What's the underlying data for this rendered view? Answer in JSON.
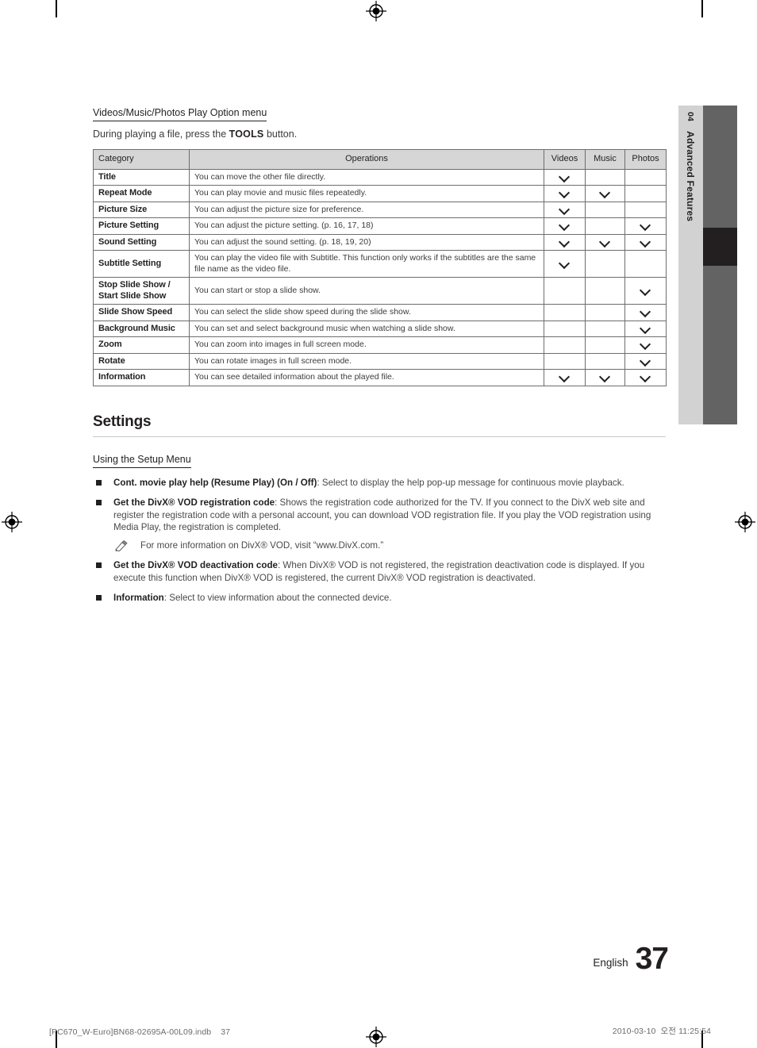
{
  "chapter_tab": {
    "number": "04",
    "name": "Advanced Features"
  },
  "play_option_section": {
    "heading": "Videos/Music/Photos Play Option menu",
    "lead_prefix": "During playing a file, press the ",
    "lead_key": "TOOLS",
    "lead_suffix": " button.",
    "table": {
      "headers": [
        "Category",
        "Operations",
        "Videos",
        "Music",
        "Photos"
      ],
      "rows": [
        {
          "category": "Title",
          "operations": "You can move the other file directly.",
          "videos": true,
          "music": false,
          "photos": false
        },
        {
          "category": "Repeat Mode",
          "operations": "You can play movie and music files repeatedly.",
          "videos": true,
          "music": true,
          "photos": false
        },
        {
          "category": "Picture Size",
          "operations": "You can adjust the picture size for preference.",
          "videos": true,
          "music": false,
          "photos": false
        },
        {
          "category": "Picture Setting",
          "operations": "You can adjust the picture setting. (p. 16, 17, 18)",
          "videos": true,
          "music": false,
          "photos": true
        },
        {
          "category": "Sound Setting",
          "operations": "You can adjust the sound setting. (p. 18, 19, 20)",
          "videos": true,
          "music": true,
          "photos": true
        },
        {
          "category": "Subtitle Setting",
          "operations": "You can play the video file with Subtitle. This function only works if the subtitles are the same file name as the video file.",
          "videos": true,
          "music": false,
          "photos": false
        },
        {
          "category": "Stop Slide Show / Start Slide Show",
          "operations": "You can start or stop a slide show.",
          "videos": false,
          "music": false,
          "photos": true
        },
        {
          "category": "Slide Show Speed",
          "operations": "You can select the slide show speed during the slide show.",
          "videos": false,
          "music": false,
          "photos": true
        },
        {
          "category": "Background Music",
          "operations": "You can set and select background music when watching a slide show.",
          "videos": false,
          "music": false,
          "photos": true
        },
        {
          "category": "Zoom",
          "operations": "You can zoom into images in full screen mode.",
          "videos": false,
          "music": false,
          "photos": true
        },
        {
          "category": "Rotate",
          "operations": "You can rotate images in full screen mode.",
          "videos": false,
          "music": false,
          "photos": true
        },
        {
          "category": "Information",
          "operations": "You can see detailed information about the played file.",
          "videos": true,
          "music": true,
          "photos": true
        }
      ]
    }
  },
  "settings_section": {
    "title": "Settings",
    "subheading": "Using the Setup Menu",
    "bullets": [
      {
        "term": "Cont. movie play help (Resume Play) (On / Off)",
        "text": ": Select to display the help pop-up message for continuous movie playback."
      },
      {
        "term": "Get the DivX® VOD registration code",
        "text": ": Shows the registration code authorized for the TV. If you connect to the DivX web site and register the registration code with a personal account, you can download VOD registration file. If you play the VOD registration using Media Play, the registration is completed.",
        "note": "For more information on DivX® VOD, visit “www.DivX.com.”"
      },
      {
        "term": "Get the DivX® VOD deactivation code",
        "text": ": When DivX® VOD is not registered, the registration deactivation code is displayed. If you execute this function when DivX® VOD is registered, the current DivX® VOD registration is deactivated."
      },
      {
        "term": "Information",
        "text": ": Select to view information about the connected device."
      }
    ]
  },
  "page_footer": {
    "language": "English",
    "page_number": "37"
  },
  "imposition_footer": {
    "file_name": "[PC670_W-Euro]BN68-02695A-00L09.indb",
    "file_page": "37",
    "date": "2010-03-10",
    "meridiem": "오전",
    "time": "11:25:54"
  },
  "colors": {
    "tab_light": "#d2d2d2",
    "tab_bar": "#636363",
    "tab_active": "#231f20",
    "table_header_bg": "#d6d6d6",
    "text": "#231f20"
  }
}
